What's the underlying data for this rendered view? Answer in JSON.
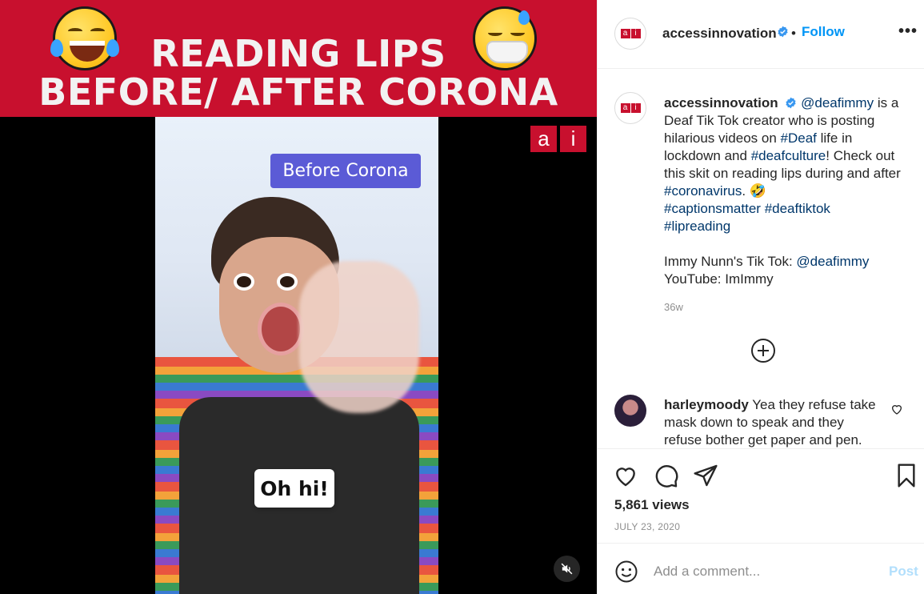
{
  "banner": {
    "line1": "READING LIPS",
    "line2": "BEFORE/ AFTER CORONA"
  },
  "video": {
    "before_label": "Before Corona",
    "subtitle": "Oh hi!",
    "logo_a": "a",
    "logo_i": "i"
  },
  "post": {
    "username": "accessinnovation",
    "follow_label": "Follow",
    "separator": "•",
    "more_label": "•••"
  },
  "caption": {
    "username": "accessinnovation",
    "mention": "@deafimmy",
    "t1": " is a Deaf Tik Tok creator who is posting hilarious videos on ",
    "tag_deaf": "#Deaf",
    "t2": " life in lockdown and ",
    "tag_deafculture": "#deafculture",
    "t3": "! Check out this skit on reading lips during and after ",
    "tag_coronavirus": "#coronavirus",
    "t4": ". 🤣",
    "tag_captions": "#captionsmatter",
    "tag_deaftiktok": "#deaftiktok",
    "tag_lipreading": "#lipreading",
    "tiktok_prefix": "Immy Nunn's Tik Tok: ",
    "tiktok_handle": "@deafimmy",
    "youtube_line": "YouTube: ImImmy",
    "age": "36w"
  },
  "comment": {
    "username": "harleymoody",
    "text": " Yea they refuse take mask down to speak and they refuse bother get paper and pen."
  },
  "stats": {
    "views": "5,861 views",
    "date": "JULY 23, 2020"
  },
  "add_comment": {
    "placeholder": "Add a comment...",
    "post_label": "Post"
  },
  "colors": {
    "brand_red": "#c8102e",
    "link_blue": "#00376b",
    "follow_blue": "#0095f6",
    "before_tag": "#5b5bd6"
  }
}
